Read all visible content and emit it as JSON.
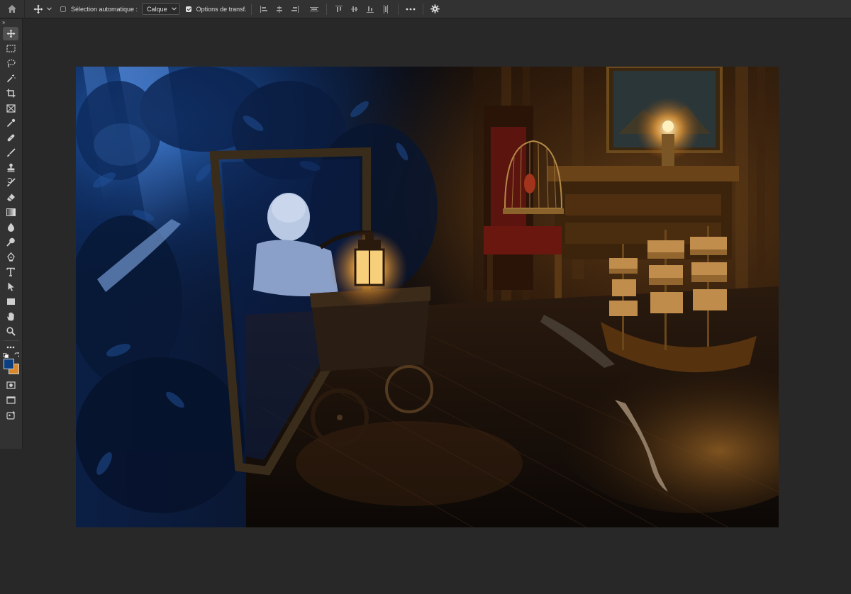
{
  "options_bar": {
    "auto_select_label": "Sélection automatique :",
    "auto_select_checked": false,
    "target_value": "Calque",
    "transform_options_label": "Options de transf.",
    "transform_options_checked": true,
    "icons": [
      "home-icon",
      "move-icon",
      "chevron-down-icon",
      "align-left-icon",
      "align-hcenter-icon",
      "align-right-icon",
      "distribute-h-icon",
      "align-top-icon",
      "align-vcenter-icon",
      "align-bottom-icon",
      "distribute-v-icon",
      "more-icon",
      "gear-icon"
    ]
  },
  "tools_panel": {
    "collapse_label": "››",
    "tools": [
      "move-tool",
      "marquee-tool",
      "lasso-tool",
      "magic-wand-tool",
      "crop-tool",
      "frame-tool",
      "eyedropper-tool",
      "healing-brush-tool",
      "brush-tool",
      "clone-stamp-tool",
      "history-brush-tool",
      "eraser-tool",
      "gradient-tool",
      "blur-tool",
      "dodge-tool",
      "pen-tool",
      "type-tool",
      "path-selection-tool",
      "rectangle-tool",
      "hand-tool",
      "zoom-tool",
      "edit-toolbar",
      "quick-mask",
      "screen-mode",
      "generate-tool"
    ],
    "foreground_color": "#0b3f7f",
    "background_color": "#d8872a"
  },
  "document": {
    "accent_left": "#1a4f9e",
    "accent_right": "#c77b2a"
  }
}
